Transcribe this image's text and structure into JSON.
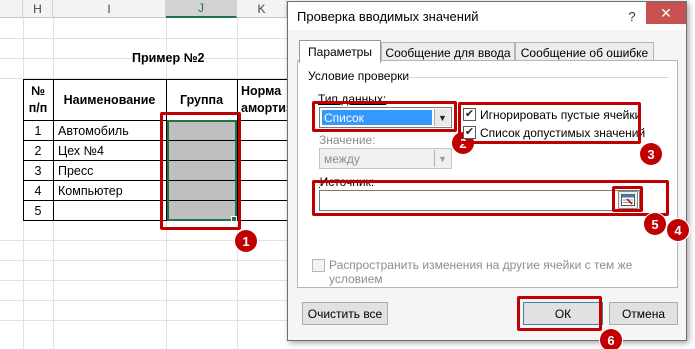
{
  "sheet": {
    "columns": [
      "H",
      "I",
      "J",
      "K"
    ],
    "example_title": "Пример №2",
    "table": {
      "headers": [
        "№\nп/п",
        "Наименование",
        "Группа",
        "Норма\nамортиз"
      ],
      "header_num_line1": "№",
      "header_num_line2": "п/п",
      "header_name": "Наименование",
      "header_group": "Группа",
      "header_norm_line1": "Норма",
      "header_norm_line2": "амортиз",
      "rows": [
        {
          "num": "1",
          "name": "Автомобиль"
        },
        {
          "num": "2",
          "name": "Цех №4"
        },
        {
          "num": "3",
          "name": "Пресс"
        },
        {
          "num": "4",
          "name": "Компьютер"
        },
        {
          "num": "5",
          "name": ""
        }
      ]
    }
  },
  "dialog": {
    "title": "Проверка вводимых значений",
    "help_glyph": "?",
    "close_glyph": "✕",
    "tabs": [
      "Параметры",
      "Сообщение для ввода",
      "Сообщение об ошибке"
    ],
    "section_label": "Условие проверки",
    "data_type_label": "Тип данных:",
    "data_type_value": "Список",
    "value_label": "Значение:",
    "value_value": "между",
    "ignore_blank_label": "Игнорировать пустые ячейки",
    "ignore_blank_checked": true,
    "dropdown_label": "Список допустимых значений",
    "dropdown_checked": true,
    "source_label": "Источник:",
    "source_value": "",
    "apply_all_line1": "Распространить изменения на другие ячейки с тем же",
    "apply_all_line2": "условием",
    "apply_all_checked": false,
    "clear_all_label": "Очистить все",
    "ok_label": "ОК",
    "cancel_label": "Отмена"
  },
  "badges": [
    "1",
    "2",
    "3",
    "4",
    "5",
    "6"
  ],
  "colors": {
    "highlight": "#c00000",
    "selection": "#3399ff",
    "excel_green": "#217346"
  }
}
